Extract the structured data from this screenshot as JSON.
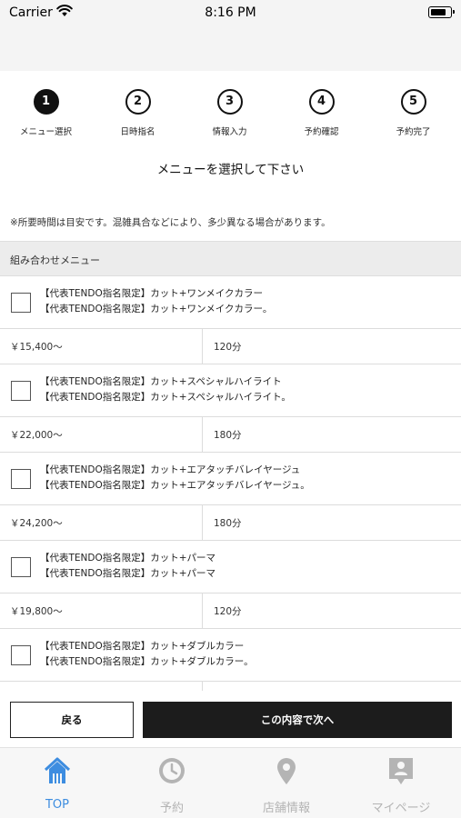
{
  "status": {
    "carrier": "Carrier",
    "time": "8:16 PM"
  },
  "steps": [
    {
      "number": "1",
      "label": "メニュー選択",
      "active": true
    },
    {
      "number": "2",
      "label": "日時指名",
      "active": false
    },
    {
      "number": "3",
      "label": "情報入力",
      "active": false
    },
    {
      "number": "4",
      "label": "予約確認",
      "active": false
    },
    {
      "number": "5",
      "label": "予約完了",
      "active": false
    }
  ],
  "page_title": "メニューを選択して下さい",
  "notice": "※所要時間は目安です。混雑具合などにより、多少異なる場合があります。",
  "section_title": "組み合わせメニュー",
  "menu_items": [
    {
      "title": "【代表TENDO指名限定】カット+ワンメイクカラー",
      "subtitle": "【代表TENDO指名限定】カット+ワンメイクカラー。",
      "price": "￥15,400〜",
      "duration": "120分"
    },
    {
      "title": "【代表TENDO指名限定】カット+スペシャルハイライト",
      "subtitle": "【代表TENDO指名限定】カット+スペシャルハイライト。",
      "price": "￥22,000〜",
      "duration": "180分"
    },
    {
      "title": "【代表TENDO指名限定】カット+エアタッチバレイヤージュ",
      "subtitle": "【代表TENDO指名限定】カット+エアタッチバレイヤージュ。",
      "price": "￥24,200〜",
      "duration": "180分"
    },
    {
      "title": "【代表TENDO指名限定】カット+パーマ",
      "subtitle": "【代表TENDO指名限定】カット+パーマ",
      "price": "￥19,800〜",
      "duration": "120分"
    },
    {
      "title": "【代表TENDO指名限定】カット+ダブルカラー",
      "subtitle": "【代表TENDO指名限定】カット+ダブルカラー。",
      "price": "",
      "duration": ""
    }
  ],
  "buttons": {
    "back": "戻る",
    "next": "この内容で次へ"
  },
  "tabs": [
    {
      "label": "TOP",
      "icon": "home-icon",
      "active": true
    },
    {
      "label": "予約",
      "icon": "clock-icon",
      "active": false
    },
    {
      "label": "店舗情報",
      "icon": "map-pin-icon",
      "active": false
    },
    {
      "label": "マイページ",
      "icon": "profile-badge-icon",
      "active": false
    }
  ],
  "colors": {
    "accent": "#3d8de0",
    "inactive_tab": "#b4b4b4",
    "primary_button": "#1c1c1c"
  }
}
